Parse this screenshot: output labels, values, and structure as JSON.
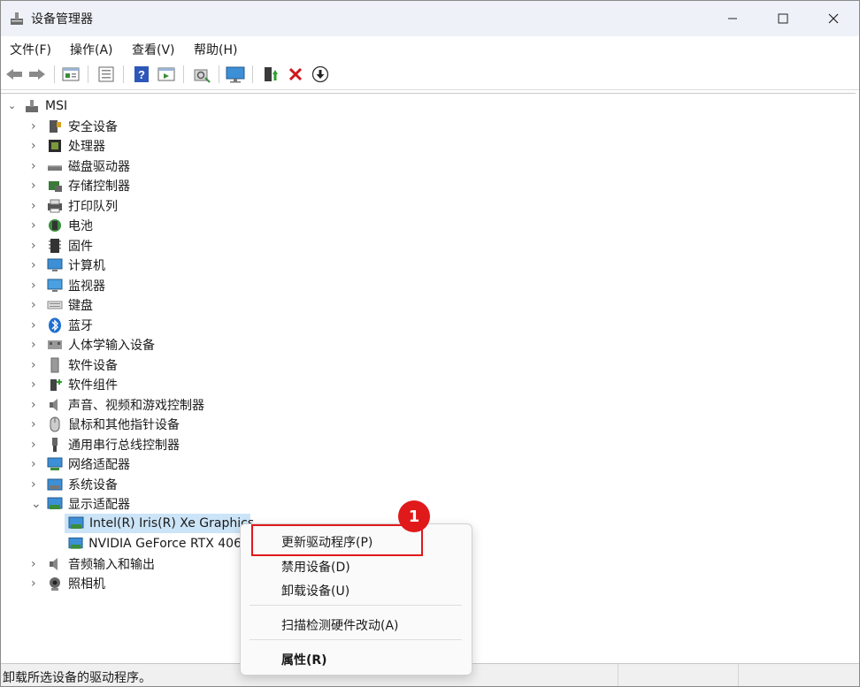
{
  "window": {
    "title": "设备管理器"
  },
  "menu": [
    "文件(F)",
    "操作(A)",
    "查看(V)",
    "帮助(H)"
  ],
  "toolbar": [
    "back-icon",
    "forward-icon",
    "properties-icon",
    "show-hidden-icon",
    "help-icon",
    "view-icon",
    "scan-icon",
    "monitor-icon",
    "update-driver-icon",
    "uninstall-icon",
    "download-icon"
  ],
  "tree": {
    "root": "MSI",
    "categories": [
      "安全设备",
      "处理器",
      "磁盘驱动器",
      "存储控制器",
      "打印队列",
      "电池",
      "固件",
      "计算机",
      "监视器",
      "键盘",
      "蓝牙",
      "人体学输入设备",
      "软件设备",
      "软件组件",
      "声音、视频和游戏控制器",
      "鼠标和其他指针设备",
      "通用串行总线控制器",
      "网络适配器",
      "系统设备",
      "显示适配器"
    ],
    "display_children": [
      "Intel(R) Iris(R) Xe Graphics",
      "NVIDIA GeForce RTX 406"
    ],
    "after": [
      "音频输入和输出",
      "照相机"
    ]
  },
  "context_menu": {
    "update": "更新驱动程序(P)",
    "disable": "禁用设备(D)",
    "uninstall": "卸载设备(U)",
    "scan": "扫描检测硬件改动(A)",
    "properties": "属性(R)"
  },
  "annotation": {
    "badge": "1"
  },
  "status": {
    "text": "卸载所选设备的驱动程序。"
  },
  "colors": {
    "accent": "#0067c0",
    "annotation": "#e0191b",
    "selection": "#cce4f7"
  }
}
